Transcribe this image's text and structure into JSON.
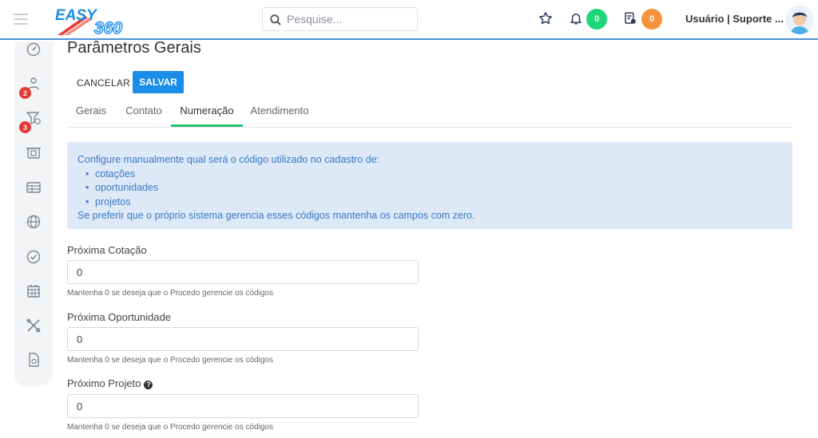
{
  "header": {
    "logo_text": "EASY 360",
    "search": {
      "placeholder": "Pesquise...",
      "value": ""
    },
    "notifications_count": "0",
    "tasks_count": "0",
    "user_label": "Usuário | Suporte ...",
    "colors": {
      "accent": "#1a8de9",
      "green_badge": "#1ed67a",
      "orange_badge": "#f5923b",
      "header_line": "#4a90d9"
    }
  },
  "sidebar": {
    "items": [
      {
        "icon": "dashboard-gauge-icon"
      },
      {
        "icon": "contacts-people-icon",
        "badge": "2"
      },
      {
        "icon": "funnel-dollar-icon",
        "badge": "3"
      },
      {
        "icon": "register-box-icon"
      },
      {
        "icon": "table-icon"
      },
      {
        "icon": "globe-icon"
      },
      {
        "icon": "check-circle-icon"
      },
      {
        "icon": "calendar-icon"
      },
      {
        "icon": "tools-icon"
      },
      {
        "icon": "document-settings-icon"
      }
    ]
  },
  "page": {
    "title": "Parâmetros Gerais",
    "cancel_label": "CANCELAR",
    "save_label": "SALVAR",
    "tabs": [
      {
        "label": "Gerais"
      },
      {
        "label": "Contato"
      },
      {
        "label": "Numeração",
        "active": true
      },
      {
        "label": "Atendimento"
      }
    ]
  },
  "info": {
    "intro": "Configure manualmente qual será o código utilizado no cadastro de:",
    "items": [
      "cotações",
      "oportunidades",
      "projetos"
    ],
    "outro": "Se preferir que o próprio sistema gerencia esses códigos mantenha os campos com zero."
  },
  "fields": [
    {
      "label": "Próxima Cotação",
      "value": "0",
      "help": "Mantenha 0 se deseja que o Procedo gerencie os códigos"
    },
    {
      "label": "Próxima Oportunidade",
      "value": "0",
      "help": "Mantenha 0 se deseja que o Procedo gerencie os códigos"
    },
    {
      "label": "Próximo Projeto",
      "value": "0",
      "help": "Mantenha 0 se deseja que o Procedo gerencie os códigos",
      "help_icon": "question-circle-icon"
    }
  ]
}
